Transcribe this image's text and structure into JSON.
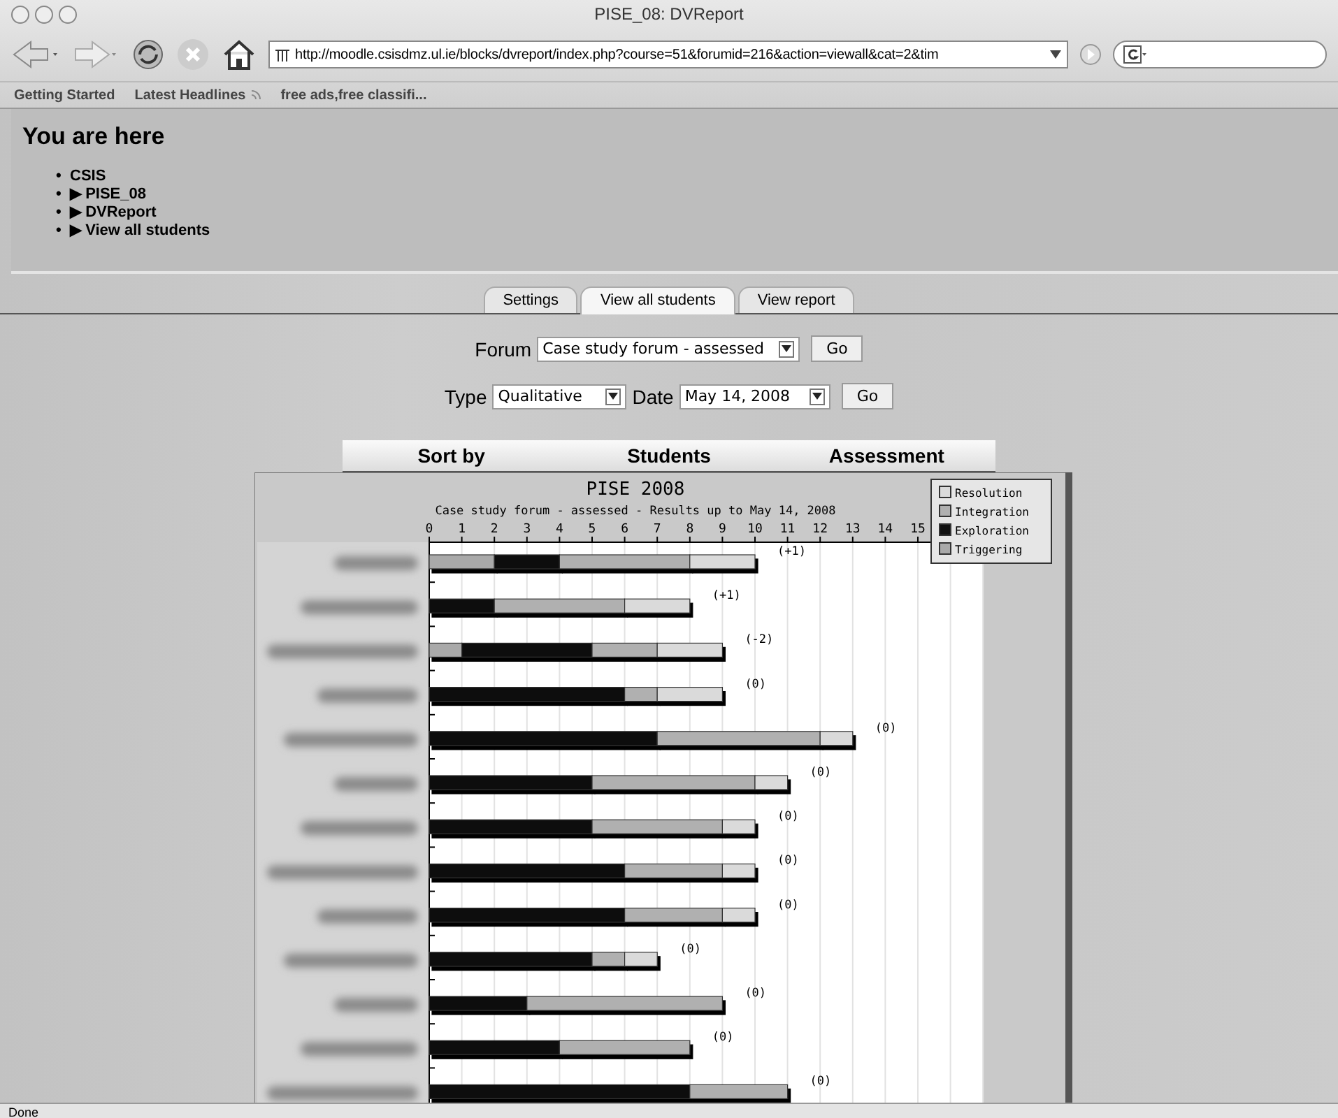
{
  "window": {
    "title": "PISE_08: DVReport"
  },
  "toolbar": {
    "address": "http://moodle.csisdmz.ul.ie/blocks/dvreport/index.php?course=51&forumid=216&action=viewall&cat=2&tim"
  },
  "bookmarks": [
    {
      "label": "Getting Started",
      "feed": false
    },
    {
      "label": "Latest Headlines",
      "feed": true
    },
    {
      "label": "free ads,free classifi...",
      "feed": false
    }
  ],
  "breadcrumb": {
    "heading": "You are here",
    "items": [
      {
        "bullet": "•",
        "label": "CSIS"
      },
      {
        "bullet": "•",
        "marker": "▶",
        "label": "PISE_08"
      },
      {
        "bullet": "•",
        "marker": "▶",
        "label": "DVReport"
      },
      {
        "bullet": "•",
        "marker": "▶",
        "label": "View all students"
      }
    ]
  },
  "tabs": [
    {
      "label": "Settings",
      "selected": false
    },
    {
      "label": "View all students",
      "selected": true
    },
    {
      "label": "View report",
      "selected": false
    }
  ],
  "form": {
    "forum_label": "Forum",
    "forum_value": "Case study forum - assessed",
    "forum_button": "Go",
    "type_label": "Type",
    "type_value": "Qualitative",
    "date_label": "Date",
    "date_value": "May 14, 2008",
    "date_button": "Go"
  },
  "sort_header": [
    "Sort by",
    "Students",
    "Assessment"
  ],
  "report": {
    "subtitle": "Case study forum - assessed - Results up to May  14, 2008",
    "chart_data": {
      "type": "bar",
      "orientation": "horizontal",
      "stacked": true,
      "title": "PISE 2008",
      "xlim": [
        0,
        17
      ],
      "xticks": [
        0,
        1,
        2,
        3,
        4,
        5,
        6,
        7,
        8,
        9,
        10,
        11,
        12,
        13,
        14,
        15
      ],
      "series": [
        {
          "name": "Triggering",
          "color": "#a9a9a9",
          "values": [
            2,
            0,
            1,
            0,
            0,
            0,
            0,
            0,
            0,
            0,
            0,
            0,
            0
          ]
        },
        {
          "name": "Exploration",
          "color": "#111111",
          "values": [
            2,
            2,
            4,
            6,
            7,
            5,
            5,
            6,
            6,
            5,
            3,
            4,
            8
          ]
        },
        {
          "name": "Integration",
          "color": "#b0b0b0",
          "values": [
            4,
            4,
            2,
            1,
            5,
            5,
            4,
            3,
            3,
            1,
            6,
            4,
            3
          ]
        },
        {
          "name": "Resolution",
          "color": "#dadada",
          "values": [
            2,
            2,
            2,
            2,
            1,
            1,
            1,
            1,
            1,
            1,
            0,
            0,
            0
          ]
        }
      ],
      "value_labels": [
        "(+1)",
        "(+1)",
        "(-2)",
        "(0)",
        "(0)",
        "(0)",
        "(0)",
        "(0)",
        "(0)",
        "(0)",
        "(0)",
        "(0)",
        "(0)"
      ],
      "legend": true,
      "grid": true
    }
  },
  "status_bar": "Done"
}
